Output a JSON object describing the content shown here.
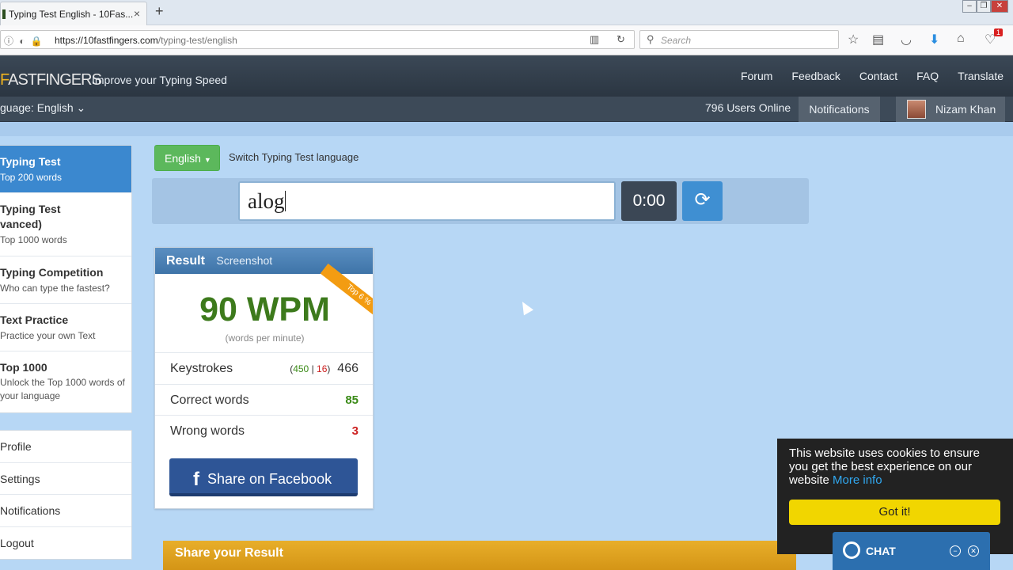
{
  "browser": {
    "tab_title": "Typing Test English - 10Fas...",
    "tab_close": "×",
    "new_tab": "+",
    "url_host": "https://10fastfingers.com",
    "url_path": "/typing-test/english",
    "search_placeholder": "Search",
    "notification_badge": "1"
  },
  "site": {
    "logo_accent": "F",
    "logo_text": "ASTFINGERS",
    "tagline": "Improve your Typing Speed",
    "nav": [
      "Forum",
      "Feedback",
      "Contact",
      "FAQ",
      "Translate"
    ],
    "language_label": "guage: English",
    "users_online": "796 Users Online",
    "notifications": "Notifications",
    "user_name": "Nizam Khan"
  },
  "sidebar": {
    "items": [
      {
        "title": "Typing Test",
        "subtitle": "Top 200 words",
        "active": true
      },
      {
        "title": "Typing Test",
        "subtitle": "Top 1000 words",
        "extra": "vanced)"
      },
      {
        "title": "Typing Competition",
        "subtitle": "Who can type the fastest?"
      },
      {
        "title": "Text Practice",
        "subtitle": "Practice your own Text"
      },
      {
        "title": "Top 1000",
        "subtitle": "Unlock the Top 1000 words of your language"
      }
    ],
    "account": [
      "Profile",
      "Settings",
      "Notifications",
      "Logout"
    ]
  },
  "test": {
    "language_button": "English",
    "switch_label": "Switch Typing Test language",
    "input_value": "alog",
    "timer": "0:00"
  },
  "result": {
    "header": "Result",
    "screenshot": "Screenshot",
    "ribbon": "Top 6 %",
    "wpm": "90 WPM",
    "wpm_sub": "(words per minute)",
    "keystrokes_label": "Keystrokes",
    "keystrokes_correct": "450",
    "keystrokes_sep": "|",
    "keystrokes_wrong": "16",
    "keystrokes_total": "466",
    "correct_label": "Correct words",
    "correct_value": "85",
    "wrong_label": "Wrong words",
    "wrong_value": "3",
    "facebook_button": "Share on Facebook"
  },
  "share_bar": "Share your Result",
  "cookie": {
    "text": "This website uses cookies to ensure you get the best experience on our website",
    "more": "More info",
    "button": "Got it!"
  },
  "chat": {
    "label": "CHAT"
  },
  "colors": {
    "accent_blue": "#3b88cf",
    "wpm_green": "#3d7a1c",
    "error_red": "#cc2020",
    "cookie_yellow": "#f1d600",
    "share_orange": "#e0a020"
  }
}
